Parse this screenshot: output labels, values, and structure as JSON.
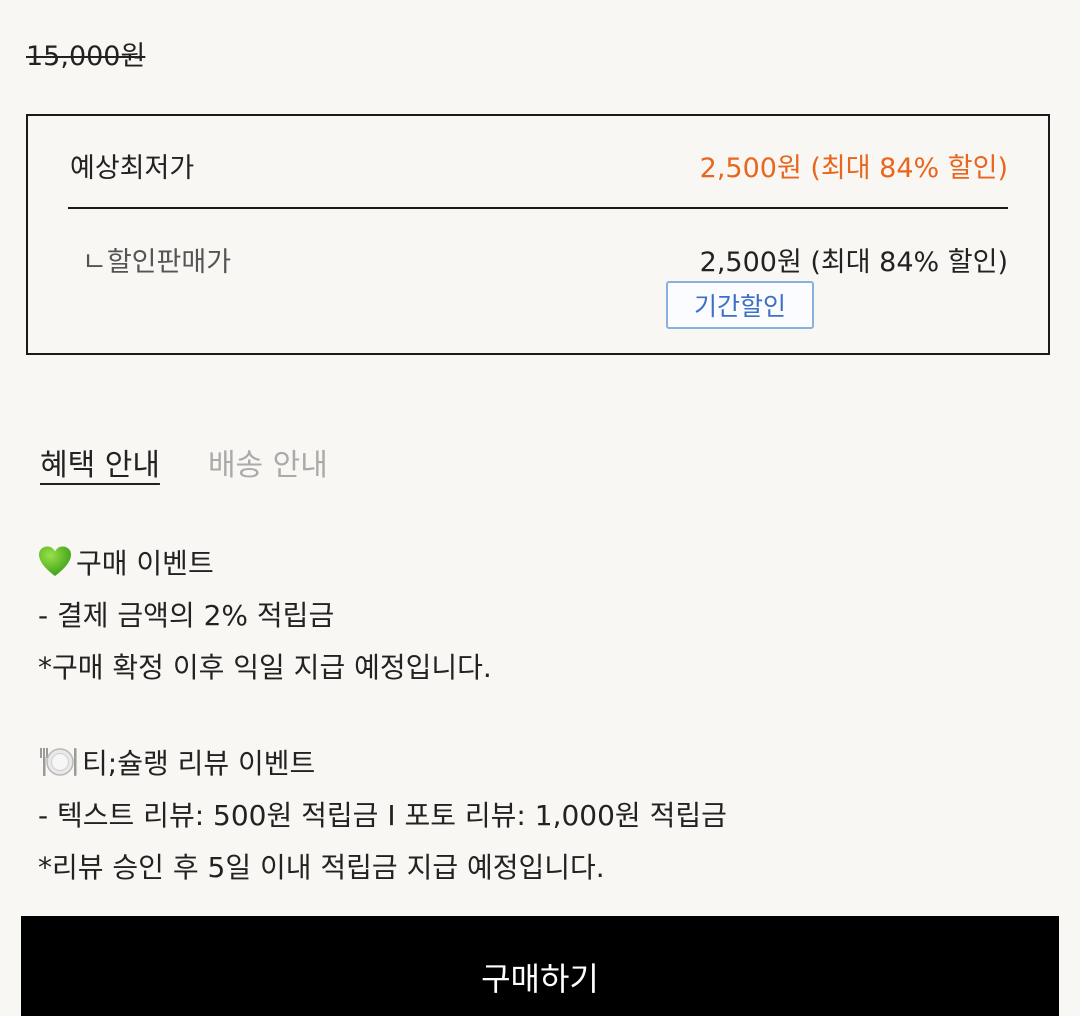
{
  "pricing": {
    "original_price": "15,000원",
    "lowest_label": "예상최저가",
    "lowest_value": "2,500원 (최대 84% 할인)",
    "sale_label": "ㄴ할인판매가",
    "sale_value": "2,500원 (최대 84% 할인)",
    "badge": "기간할인",
    "accent_color": "#e8661e"
  },
  "tabs": [
    {
      "label": "혜택 안내",
      "active": true
    },
    {
      "label": "배송 안내",
      "active": false
    }
  ],
  "benefits": {
    "purchase_event": {
      "icon": "green-heart-icon",
      "title": "구매 이벤트",
      "line1": "- 결제 금액의 2% 적립금",
      "line2": "*구매 확정 이후 익일 지급 예정입니다."
    },
    "review_event": {
      "icon": "plate-cutlery-icon",
      "title": "티;슐랭 리뷰 이벤트",
      "line1": "- 텍스트 리뷰: 500원 적립금 I 포토 리뷰: 1,000원 적립금",
      "line2": "*리뷰 승인 후 5일 이내 적립금 지급 예정입니다."
    }
  },
  "buy_button": "구매하기"
}
